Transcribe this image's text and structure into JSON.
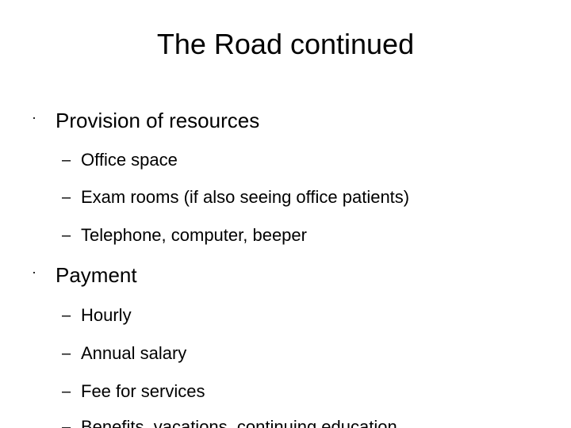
{
  "slide": {
    "title": "The Road continued",
    "sections": [
      {
        "bullet": "·",
        "heading": "Provision of resources",
        "items": [
          {
            "dash": "–",
            "text": "Office space"
          },
          {
            "dash": "–",
            "text": "Exam rooms (if also seeing office patients)"
          },
          {
            "dash": "–",
            "text": "Telephone, computer, beeper"
          }
        ]
      },
      {
        "bullet": "·",
        "heading": "Payment",
        "items": [
          {
            "dash": "–",
            "text": "Hourly"
          },
          {
            "dash": "–",
            "text": "Annual salary"
          },
          {
            "dash": "–",
            "text": "Fee for services"
          },
          {
            "dash": "–",
            "text": "Benefits, vacations, continuing education"
          }
        ]
      }
    ]
  }
}
